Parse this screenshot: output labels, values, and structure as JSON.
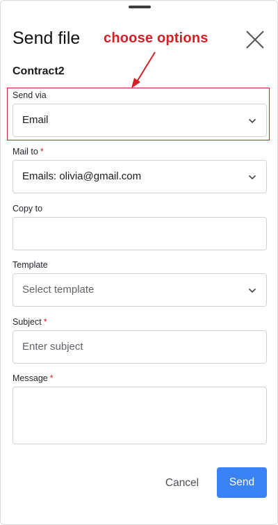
{
  "dialog": {
    "title": "Send file",
    "document_name": "Contract2"
  },
  "annotation": {
    "text": "choose options",
    "color": "#d32026"
  },
  "form": {
    "send_via": {
      "label": "Send via",
      "value": "Email"
    },
    "mail_to": {
      "label": "Mail to",
      "required_mark": "*",
      "value": "Emails: olivia@gmail.com"
    },
    "copy_to": {
      "label": "Copy to",
      "value": ""
    },
    "template": {
      "label": "Template",
      "placeholder": "Select template"
    },
    "subject": {
      "label": "Subject",
      "required_mark": "*",
      "placeholder": "Enter subject"
    },
    "message": {
      "label": "Message",
      "required_mark": "*",
      "value": ""
    }
  },
  "actions": {
    "cancel_label": "Cancel",
    "send_label": "Send"
  },
  "colors": {
    "primary": "#3b82f6",
    "required": "#d32026"
  },
  "icons": {
    "close": "close-icon",
    "dropdown": "chevron-down-icon"
  }
}
